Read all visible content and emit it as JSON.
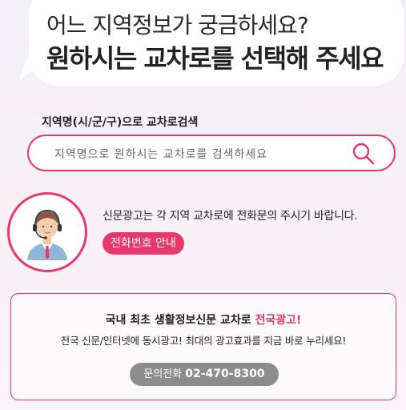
{
  "header": {
    "line1": "어느 지역정보가 궁금하세요?",
    "line2": "원하시는 교차로를 선택해 주세요"
  },
  "search": {
    "title": "지역명(시/군/구)으로 교차로검색",
    "placeholder": "지역명으로 원하시는 교차로를 검색하세요",
    "button_icon": "search-icon"
  },
  "call_center": {
    "description": "신문광고는 각 지역 교차로에 전화문의 주시기 바랍니다.",
    "button_label": "전화번호 안내",
    "icon": "headset-agent-icon"
  },
  "ad": {
    "title_prefix": "국내 최초 생활정보신문 교차로 ",
    "title_accent": "전국광고!",
    "description": "전국 신문/인터넷에 동시광고! 최대의 광고효과를 지금 바로 누리세요!",
    "contact_label": "문의전화",
    "contact_number": "02-470-8300"
  },
  "colors": {
    "accent": "#e8376c",
    "button_gray": "#8c8c8c"
  }
}
